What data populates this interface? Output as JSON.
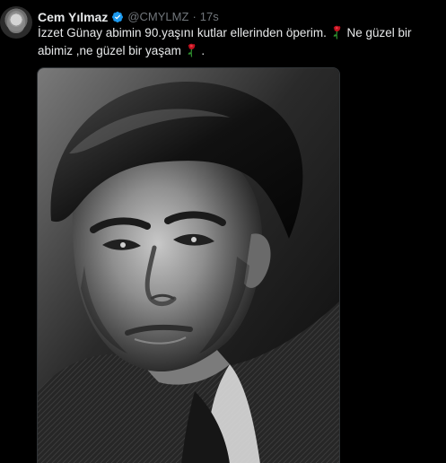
{
  "tweet": {
    "author_name": "Cem Yılmaz",
    "handle": "@CMYLMZ",
    "separator": "·",
    "time": "17s",
    "text_part1": "İzzet Günay abimin 90.yaşını kutlar ellerinden öperim.",
    "text_part2": "Ne güzel bir abimiz ,ne güzel bir yaşam",
    "text_part3": ".",
    "icons": {
      "verified": "verified-badge-icon",
      "rose": "rose-emoji"
    }
  },
  "colors": {
    "background": "#000000",
    "text": "#e7e9ea",
    "secondary": "#71767b",
    "verified": "#1d9bf0",
    "border": "#2f3336"
  }
}
